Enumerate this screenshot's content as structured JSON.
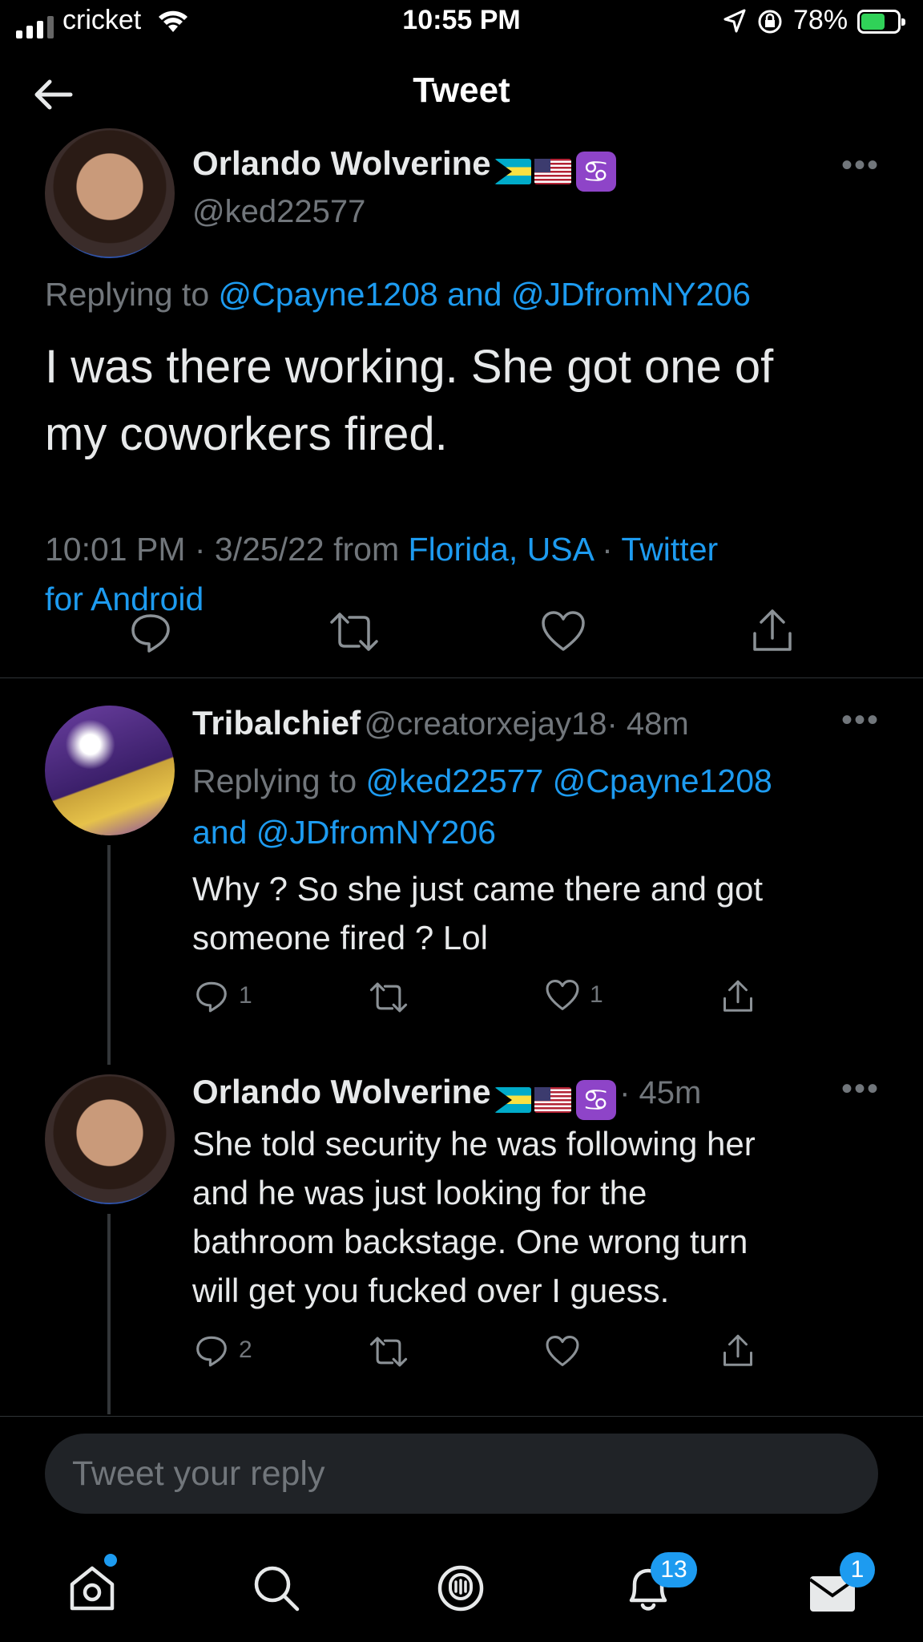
{
  "status_bar": {
    "carrier": "cricket",
    "time": "10:55 PM",
    "battery": "78%"
  },
  "header": {
    "title": "Tweet"
  },
  "main_tweet": {
    "name": "Orlando Wolverine",
    "handle": "@ked22577",
    "replying_prefix": "Replying to",
    "replying_to": "@Cpayne1208 and @JDfromNY206",
    "text_line1": "I was there working. She got one of",
    "text_line2": "my coworkers fired.",
    "timestamp": "10:01 PM · 3/25/22 from",
    "location": "Florida, USA",
    "separator": "·",
    "source_line1": "Twitter",
    "source_line2": "for Android"
  },
  "reply1": {
    "name": "Tribalchief",
    "handle": "@creatorxejay18",
    "time": "· 48m",
    "replying_prefix": "Replying to",
    "replying_line1": "@ked22577 @Cpayne1208",
    "replying_line2": "and @JDfromNY206",
    "text_line1": "Why ? So she just came there and got",
    "text_line2": "someone fired ? Lol",
    "reply_count": "1",
    "like_count": "1"
  },
  "reply2": {
    "name": "Orlando Wolverine",
    "time": "· 45m",
    "text_line1": "She told security he was following her",
    "text_line2": "and he was just looking for the",
    "text_line3": "bathroom backstage. One wrong turn",
    "text_line4": "will get you fucked over I guess.",
    "reply_count": "2"
  },
  "reply_box": {
    "placeholder": "Tweet your reply"
  },
  "bottom_nav": {
    "notifications_badge": "13",
    "messages_badge": "1"
  },
  "colors": {
    "accent": "#1d9bf0",
    "background": "#000000",
    "muted": "#71767b"
  }
}
